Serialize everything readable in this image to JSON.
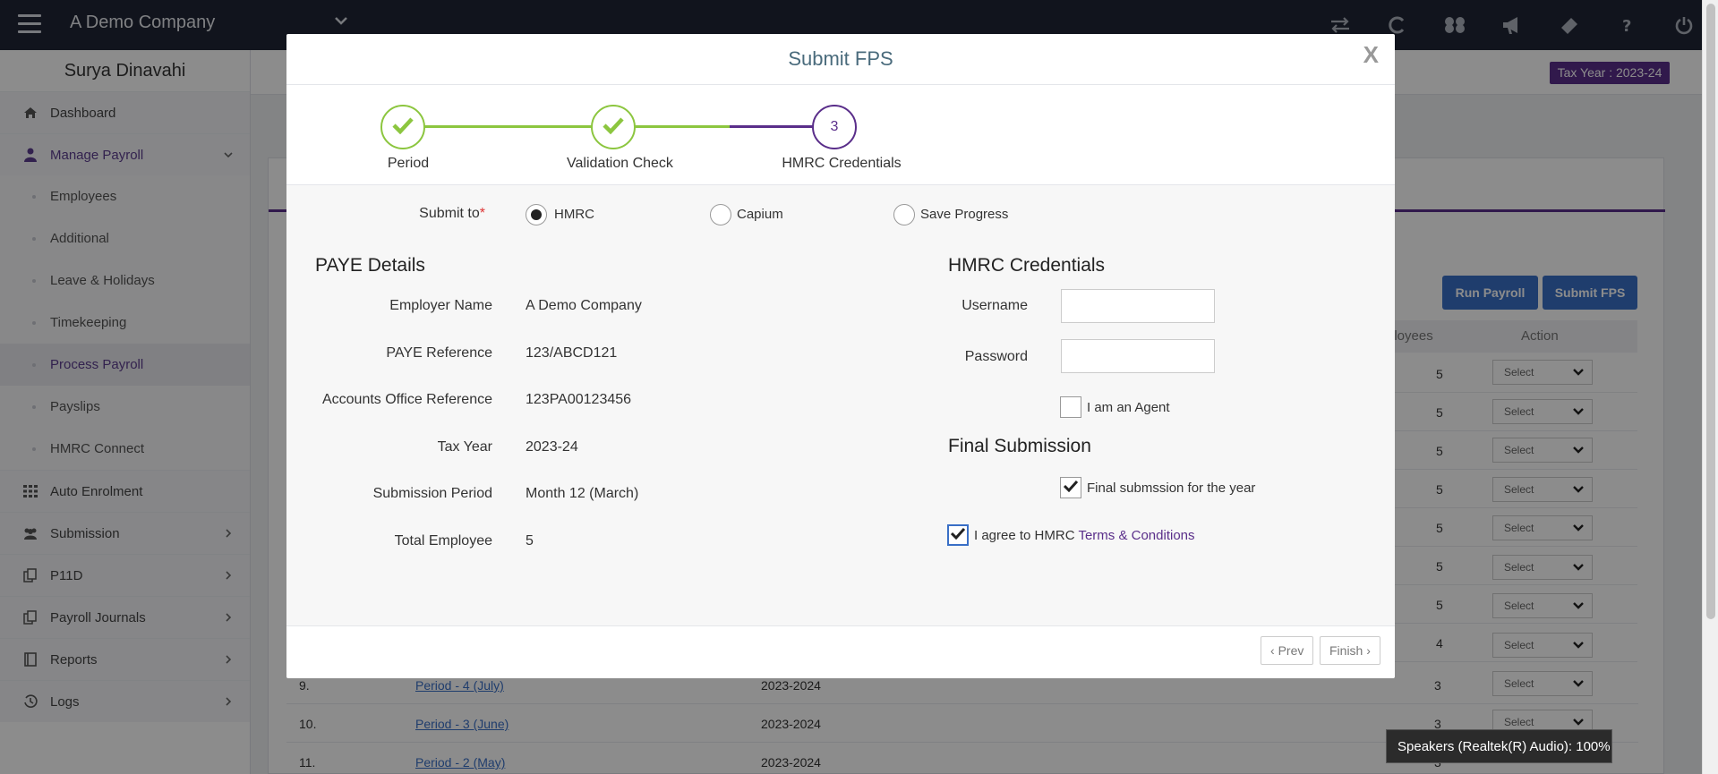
{
  "topbar": {
    "company": "A Demo Company",
    "icons": [
      "exchange-icon",
      "refresh-c-icon",
      "dropbox-icon",
      "megaphone-icon",
      "ticket-icon",
      "help-icon",
      "power-icon"
    ]
  },
  "sidebar": {
    "user": "Surya Dinavahi",
    "items": [
      {
        "label": "Dashboard",
        "icon": "home-icon"
      },
      {
        "label": "Manage Payroll",
        "icon": "user-icon"
      },
      {
        "label": "Auto Enrolment",
        "icon": "grid-icon"
      },
      {
        "label": "Submission",
        "icon": "users-icon"
      },
      {
        "label": "P11D",
        "icon": "copy-icon"
      },
      {
        "label": "Payroll Journals",
        "icon": "copy-icon"
      },
      {
        "label": "Reports",
        "icon": "book-icon"
      },
      {
        "label": "Logs",
        "icon": "history-icon"
      }
    ],
    "sub": [
      "Employees",
      "Additional",
      "Leave & Holidays",
      "Timekeeping",
      "Process Payroll",
      "Payslips",
      "HMRC Connect"
    ]
  },
  "background": {
    "tax_year_badge": "Tax Year : 2023-24",
    "run_payroll": "Run Payroll",
    "submit_fps": "Submit FPS",
    "col_employees": "ployees",
    "col_action": "Action",
    "select_label": "Select",
    "employee_counts": [
      "5",
      "5",
      "5",
      "5",
      "5",
      "5",
      "5",
      "4"
    ],
    "rows": [
      {
        "num": "9.",
        "period": "Period - 4 (July)",
        "year": "2023-2024",
        "emp": "3"
      },
      {
        "num": "10.",
        "period": "Period - 3 (June)",
        "year": "2023-2024",
        "emp": "3"
      },
      {
        "num": "11.",
        "period": "Period - 2 (May)",
        "year": "2023-2024",
        "emp": "3"
      }
    ]
  },
  "modal": {
    "title": "Submit FPS",
    "close": "X",
    "steps": [
      {
        "label": "Period",
        "state": "done"
      },
      {
        "label": "Validation Check",
        "state": "done"
      },
      {
        "label": "HMRC Credentials",
        "state": "current",
        "number": "3"
      }
    ],
    "submit_to": {
      "label": "Submit to",
      "required_mark": "*",
      "options": [
        "HMRC",
        "Capium",
        "Save Progress"
      ],
      "selected": "HMRC"
    },
    "paye": {
      "heading": "PAYE Details",
      "fields": [
        {
          "label": "Employer Name",
          "value": "A Demo Company"
        },
        {
          "label": "PAYE Reference",
          "value": "123/ABCD121"
        },
        {
          "label": "Accounts Office Reference",
          "value": "123PA00123456"
        },
        {
          "label": "Tax Year",
          "value": "2023-24"
        },
        {
          "label": "Submission Period",
          "value": "Month 12 (March)"
        },
        {
          "label": "Total Employee",
          "value": "5"
        }
      ]
    },
    "credentials": {
      "heading": "HMRC Credentials",
      "username_label": "Username",
      "username_value": "",
      "password_label": "Password",
      "password_value": "",
      "agent_label": "I am an Agent",
      "agent_checked": false
    },
    "final": {
      "heading": "Final Submission",
      "final_label": "Final submssion for the year",
      "final_checked": true,
      "agree_prefix": "I agree to HMRC",
      "agree_link": "Terms & Conditions",
      "agree_checked": true
    },
    "footer": {
      "prev": "Prev",
      "finish": "Finish"
    }
  },
  "toast": "Speakers (Realtek(R) Audio): 100%",
  "colors": {
    "brand": "#5a2e8a",
    "step_done": "#8cc63f",
    "link": "#3a6fc6",
    "topbar": "#1f2535"
  }
}
